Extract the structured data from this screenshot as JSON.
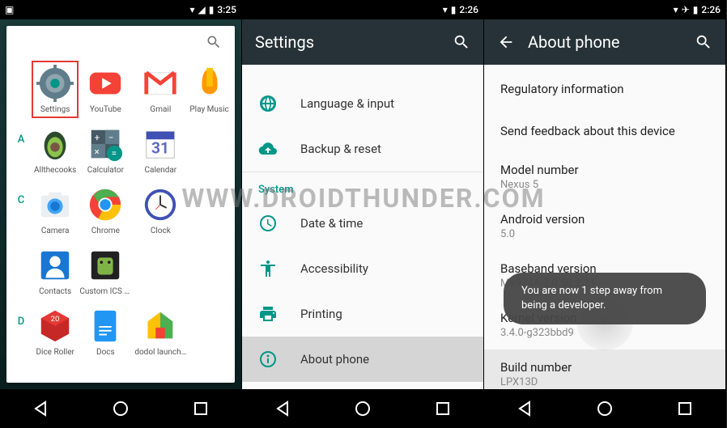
{
  "watermark": "WWW.DROIDTHUNDER.COM",
  "phone1": {
    "time": "3:25",
    "apps": [
      {
        "name": "Settings",
        "selected": true
      },
      {
        "name": "YouTube"
      },
      {
        "name": "Gmail"
      },
      {
        "name": "Play Music"
      },
      {
        "name": "Allthecooks"
      },
      {
        "name": "Calculator"
      },
      {
        "name": "Calendar"
      },
      {
        "name": "Camera"
      },
      {
        "name": "Chrome"
      },
      {
        "name": "Clock"
      },
      {
        "name": "Contacts"
      },
      {
        "name": "Custom ICS Sear..."
      },
      {
        "name": "Dice Roller"
      },
      {
        "name": "Docs"
      },
      {
        "name": "dodol launcher"
      }
    ],
    "index_letters": [
      "A",
      "C",
      "D"
    ]
  },
  "phone2": {
    "time": "2:26",
    "title": "Settings",
    "items": [
      {
        "label": "Language & input"
      },
      {
        "label": "Backup & reset"
      }
    ],
    "section_header": "System",
    "system_items": [
      {
        "label": "Date & time"
      },
      {
        "label": "Accessibility"
      },
      {
        "label": "Printing"
      },
      {
        "label": "About phone",
        "pressed": true
      }
    ]
  },
  "phone3": {
    "time": "2:26",
    "title": "About phone",
    "items": [
      {
        "title": "Regulatory information"
      },
      {
        "title": "Send feedback about this device"
      },
      {
        "title": "Model number",
        "sub": "Nexus 5"
      },
      {
        "title": "Android version",
        "sub": "5.0"
      },
      {
        "title": "Baseband version",
        "sub": "M8974A-2.0.50.2.21"
      },
      {
        "title": "Kernel version",
        "sub": "3.4.0-g323bbd9"
      },
      {
        "title": "Build number",
        "sub": "LPX13D",
        "pressed": true
      }
    ],
    "toast": "You are now 1 step away from being a developer."
  }
}
